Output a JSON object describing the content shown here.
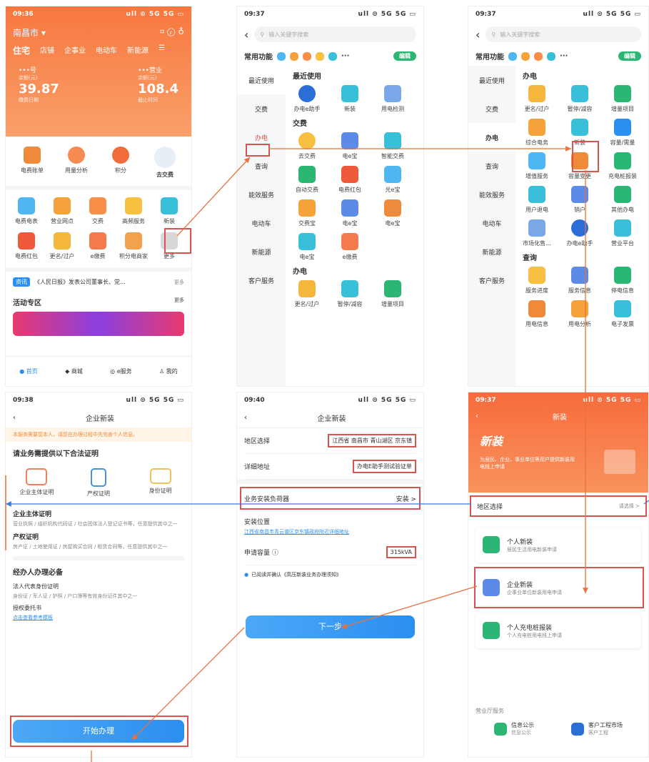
{
  "p1": {
    "time": "09:36",
    "status": "ull ⊙ 5G 5G ▭",
    "city": "南昌市",
    "tabs": [
      "住宅",
      "店铺",
      "企事业",
      "电动车",
      "新能源"
    ],
    "acc1": {
      "label": "•••号",
      "sub": "余额(元)",
      "value": "39.87",
      "note": "缴费日期"
    },
    "acc2": {
      "label": "•••营业",
      "sub": "余额(元)",
      "value": "108.4",
      "note": "截止时间"
    },
    "quick": [
      "电费账单",
      "用量分析",
      "积分",
      "去交费"
    ],
    "grid": [
      "电费电表",
      "营业网点",
      "交费",
      "高频服务",
      "新装",
      "电费红包",
      "更名/过户",
      "e缴费",
      "积分电商家",
      "更多"
    ],
    "news_tag": "资讯",
    "news": "《人民日报》发表公司董事长、党...",
    "news_more": "更多",
    "activity": "活动专区",
    "activity_more": "更多",
    "nav": [
      "首页",
      "商城",
      "e服务",
      "我的"
    ]
  },
  "p2": {
    "time": "09:37",
    "status": "ull ⊙ 5G 5G ▭",
    "search": "输入关键字搜索",
    "common": "常用功能",
    "edit": "编辑",
    "cats": [
      "最近使用",
      "交费",
      "办电",
      "查询",
      "能效服务",
      "电动车",
      "新能源",
      "客户服务"
    ],
    "sec_recent": "最近使用",
    "recent": [
      "办电e助手",
      "新装",
      "用电检测"
    ],
    "sec_pay": "交费",
    "pay": [
      "去交费",
      "电e宝",
      "智能交费",
      "自动交费",
      "电费红包",
      "光e宝",
      "交费宝",
      "电e宝",
      "电e宝",
      "电e宝",
      "e缴费"
    ],
    "sec_ban": "办电",
    "ban": [
      "更名/过户",
      "暂停/减容",
      "增量项目"
    ]
  },
  "p3": {
    "time": "09:37",
    "status": "ull ⊙ 5G 5G ▭",
    "search": "输入关键字搜索",
    "common": "常用功能",
    "edit": "编辑",
    "cats": [
      "最近使用",
      "交费",
      "办电",
      "查询",
      "能效服务",
      "电动车",
      "新能源",
      "客户服务"
    ],
    "sec_ban": "办电",
    "ban": [
      "更名/过户",
      "暂停/减容",
      "增量项目",
      "综合电务",
      "新装",
      "容量/需量",
      "增值服务",
      "容量变更",
      "充电桩报装",
      "用户退电",
      "销户",
      "其他办电",
      "市场化售...",
      "办电e助手",
      "营业平台"
    ],
    "sec_query": "查询",
    "query": [
      "服务进度",
      "服务信息",
      "停电信息",
      "用电信息",
      "用电分析",
      "电子发票"
    ]
  },
  "p4": {
    "time": "09:38",
    "status": "ull ⊙ 5G 5G ▭",
    "title": "企业新装",
    "notice": "本服务需要您本人，请您在办理过程中先完善个人信息。",
    "head": "请业务需提供以下合法证明",
    "docs": [
      "企业主体证明",
      "产权证明",
      "身份证明"
    ],
    "s1_title": "企业主体证明",
    "s1_text": "营业执照 / 组织机构代码证 / 社会团体法人登记证书等，任意提供其中之一",
    "s2_title": "产权证明",
    "s2_text": "房产证 / 土地使用证 / 房屋购买合同 / 租赁合同等，任意提供其中之一",
    "s3_title": "经办人办理必备",
    "s3_a": "法人代表身份证明",
    "s3_b": "身份证 / 军人证 / 护照 / 户口簿等有效身份证件其中之一",
    "s3_c": "授权委托书",
    "s3_d": "点击查看参考模板",
    "btn": "开始办理"
  },
  "p5": {
    "time": "09:40",
    "status": "ull ⊙ 5G 5G ▭",
    "title": "企业新装",
    "r1": "地区选择",
    "r1v": "江西省 南昌市 青山湖区 京东镇",
    "r2": "详细地址",
    "r2v": "办电E助手测试验证单",
    "r3": "业务安装负荷器",
    "r3v": "安装 >",
    "r4": "安装位置",
    "r4v": "江西省南昌市青云谱区京东镇政府附近详细地址",
    "r5": "申请容量",
    "r5v": "315kVA",
    "agree": "已阅读并确认《高压新装业务办理须知》",
    "btn": "下一步"
  },
  "p6": {
    "time": "09:37",
    "status": "ull ⊙ 5G 5G ▭",
    "title": "新装",
    "banner_title": "新装",
    "banner_sub": "为居民、企业、事业单位等用户提供新装用电线上申请",
    "region": "地区选择",
    "region_v": "请选择 >",
    "cards": [
      {
        "t": "个人新装",
        "s": "居民生活用电新装申请"
      },
      {
        "t": "企业新装",
        "s": "企事业单位新装用电申请"
      },
      {
        "t": "个人充电桩报装",
        "s": "个人充电桩用电线上申请"
      }
    ],
    "bottom_title": "营业厅服务",
    "bottom": [
      {
        "t": "信息公示",
        "s": "信息公示"
      },
      {
        "t": "客户工程市场",
        "s": "客户工程"
      }
    ]
  },
  "colors": {
    "orange": "#f7874e",
    "blue": "#2b8ff0",
    "red": "#d9534f"
  }
}
